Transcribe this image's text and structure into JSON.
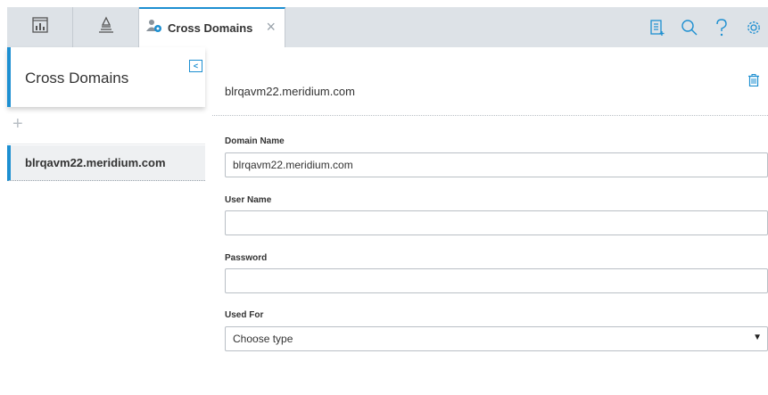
{
  "toolbar": {
    "tabs": [
      {
        "icon": "dashboard-icon"
      },
      {
        "icon": "hierarchy-icon"
      }
    ],
    "active_tab": {
      "icon": "users-gear-icon",
      "label": "Cross Domains",
      "close": "×"
    },
    "right_icons": [
      "new-record-icon",
      "search-icon",
      "help-icon",
      "settings-gear-icon"
    ],
    "accent_color": "#1d8fd1"
  },
  "left_panel": {
    "title": "Cross Domains",
    "collapse_glyph": "<",
    "add_glyph": "+",
    "items": [
      {
        "label": "blrqavm22.meridium.com"
      }
    ]
  },
  "main": {
    "title": "blrqavm22.meridium.com",
    "fields": {
      "domain_name": {
        "label": "Domain Name",
        "value": "blrqavm22.meridium.com"
      },
      "user_name": {
        "label": "User Name",
        "value": ""
      },
      "password": {
        "label": "Password",
        "value": ""
      },
      "used_for": {
        "label": "Used For",
        "selected": "Choose type",
        "arrow": "▼"
      }
    }
  }
}
